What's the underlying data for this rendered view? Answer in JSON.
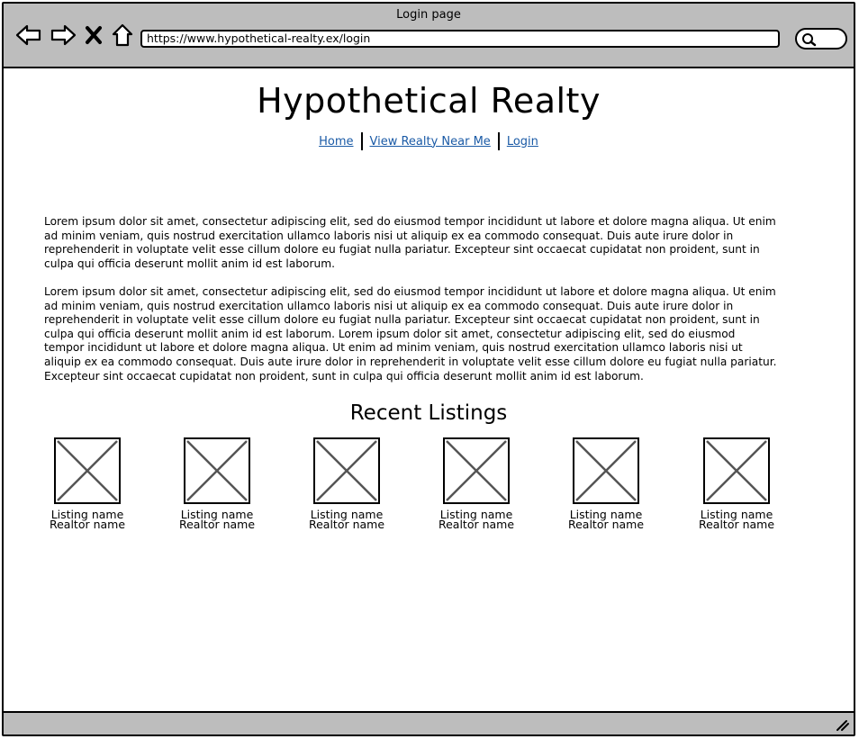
{
  "window": {
    "title": "Login page"
  },
  "toolbar": {
    "icons": [
      "back-icon",
      "forward-icon",
      "close-icon",
      "home-icon"
    ],
    "url": "https://www.hypothetical-realty.ex/login",
    "search_icon": "search-icon"
  },
  "header": {
    "title": "Hypothetical Realty",
    "nav": [
      {
        "label": "Home"
      },
      {
        "label": "View Realty Near Me"
      },
      {
        "label": "Login"
      }
    ]
  },
  "content": {
    "paragraphs": [
      "Lorem ipsum dolor sit amet, consectetur adipiscing elit, sed do eiusmod tempor incididunt ut labore et dolore magna aliqua. Ut enim ad minim veniam, quis nostrud exercitation ullamco laboris nisi ut aliquip ex ea commodo consequat. Duis aute irure dolor in reprehenderit in voluptate velit esse cillum dolore eu fugiat nulla pariatur. Excepteur sint occaecat cupidatat non proident, sunt in culpa qui officia deserunt mollit anim id est laborum.",
      "Lorem ipsum dolor sit amet, consectetur adipiscing elit, sed do eiusmod tempor incididunt ut labore et dolore magna aliqua. Ut enim ad minim veniam, quis nostrud exercitation ullamco laboris nisi ut aliquip ex ea commodo consequat. Duis aute irure dolor in reprehenderit in voluptate velit esse cillum dolore eu fugiat nulla pariatur. Excepteur sint occaecat cupidatat non proident, sunt in culpa qui officia deserunt mollit anim id est laborum. Lorem ipsum dolor sit amet, consectetur adipiscing elit, sed do eiusmod tempor incididunt ut labore et dolore magna aliqua. Ut enim ad minim veniam, quis nostrud exercitation ullamco laboris nisi ut aliquip ex ea commodo consequat. Duis aute irure dolor in reprehenderit in voluptate velit esse cillum dolore eu fugiat nulla pariatur. Excepteur sint occaecat cupidatat non proident, sunt in culpa qui officia deserunt mollit anim id est laborum."
    ]
  },
  "listings": {
    "title": "Recent Listings",
    "items": [
      {
        "name": "Listing name",
        "realtor": "Realtor name"
      },
      {
        "name": "Listing name",
        "realtor": "Realtor name"
      },
      {
        "name": "Listing name",
        "realtor": "Realtor name"
      },
      {
        "name": "Listing name",
        "realtor": "Realtor name"
      },
      {
        "name": "Listing name",
        "realtor": "Realtor name"
      },
      {
        "name": "Listing name",
        "realtor": "Realtor name"
      }
    ]
  },
  "colors": {
    "chrome": "#bdbdbd",
    "link": "#1a5aa6"
  }
}
